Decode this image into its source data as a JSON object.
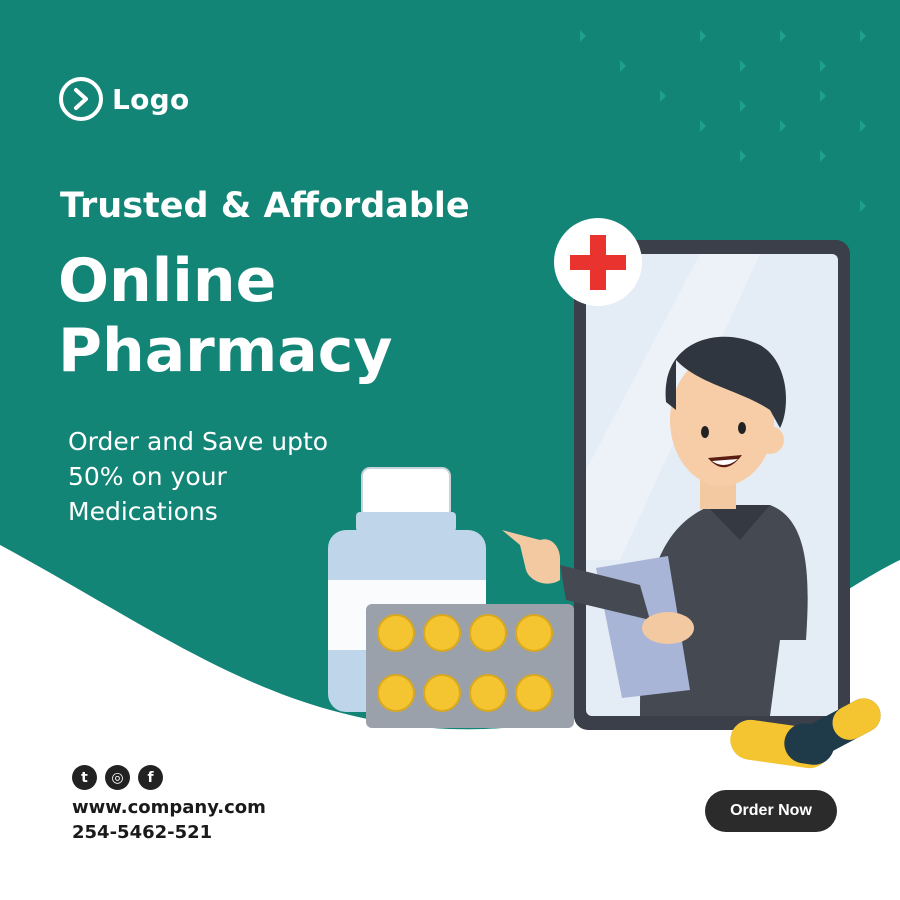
{
  "brand": {
    "logo_text": "Logo"
  },
  "hero": {
    "headline_line1": "Trusted & Affordable",
    "headline_line2": "Online Pharmacy",
    "subtext": "Order and Save upto 50% on your Medications"
  },
  "social": [
    {
      "name": "twitter-icon",
      "glyph": "t"
    },
    {
      "name": "instagram-icon",
      "glyph": "◎"
    },
    {
      "name": "facebook-icon",
      "glyph": "f"
    }
  ],
  "contact": {
    "website": "www.company.com",
    "phone": "254-5462-521"
  },
  "cta": {
    "label": "Order Now"
  },
  "colors": {
    "teal": "#138576",
    "white": "#ffffff",
    "dark": "#2b2b2b",
    "pill_yellow": "#f5c431",
    "cross_red": "#e8332f"
  }
}
